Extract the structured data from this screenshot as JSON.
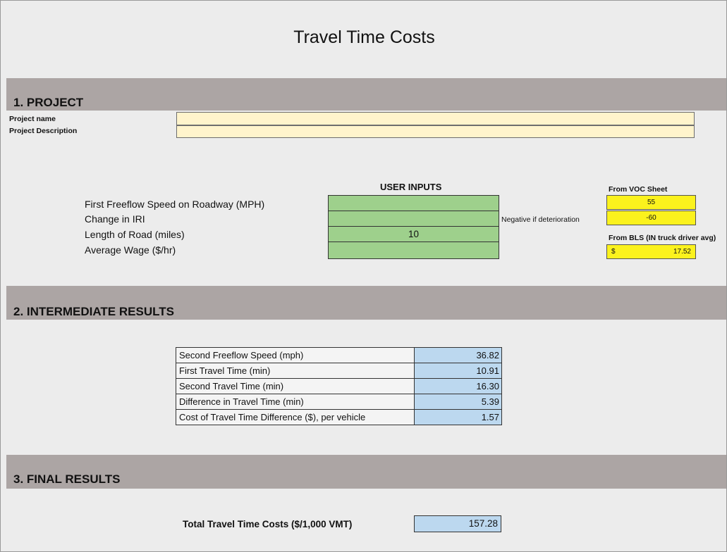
{
  "title": "Travel Time Costs",
  "sections": {
    "project": "1. PROJECT",
    "intermediate": "2. INTERMEDIATE RESULTS",
    "final": "3. FINAL RESULTS"
  },
  "project": {
    "name_label": "Project name",
    "name_value": "",
    "description_label": "Project Description",
    "description_value": ""
  },
  "inputs": {
    "header": "USER INPUTS",
    "rows": [
      {
        "label": "First Freeflow Speed on Roadway (MPH)",
        "value": ""
      },
      {
        "label": "Change in IRI",
        "value": ""
      },
      {
        "label": "Length of Road (miles)",
        "value": "10"
      },
      {
        "label": "Average Wage ($/hr)",
        "value": ""
      }
    ],
    "negative_note": "Negative if deterioration"
  },
  "voc": {
    "header": "From VOC Sheet",
    "speed": "55",
    "iri": "-60"
  },
  "bls": {
    "header": "From BLS (IN truck driver avg)",
    "currency": "$",
    "wage": "17.52"
  },
  "intermediate": [
    {
      "label": "Second Freeflow Speed (mph)",
      "value": "36.82"
    },
    {
      "label": "First Travel Time (min)",
      "value": "10.91"
    },
    {
      "label": "Second Travel Time (min)",
      "value": "16.30"
    },
    {
      "label": "Difference in Travel Time (min)",
      "value": "5.39"
    },
    {
      "label": "Cost of Travel Time Difference ($), per vehicle",
      "value": "1.57"
    }
  ],
  "final": {
    "label": "Total Travel Time Costs ($/1,000 VMT)",
    "value": "157.28"
  },
  "colors": {
    "band": "#aca5a4",
    "project_field": "#fff4cc",
    "input_green": "#9ed08c",
    "voc_yellow": "#fbf21d",
    "result_blue": "#bcd8ef"
  }
}
